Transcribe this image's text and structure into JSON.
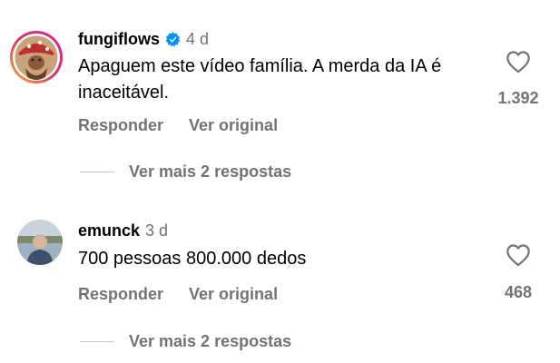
{
  "comments": [
    {
      "username": "fungiflows",
      "verified": true,
      "time": "4 d",
      "text": "Apaguem este vídeo família. A merda da IA é inaceitável.",
      "reply_label": "Responder",
      "original_label": "Ver original",
      "likes": "1.392",
      "more_replies": "Ver mais 2 respostas"
    },
    {
      "username": "emunck",
      "verified": false,
      "time": "3 d",
      "text": "700 pessoas 800.000 dedos",
      "reply_label": "Responder",
      "original_label": "Ver original",
      "likes": "468",
      "more_replies": "Ver mais 2 respostas"
    }
  ],
  "icons": {
    "like": "heart-outline-icon",
    "verified": "verified-badge-icon"
  },
  "colors": {
    "secondary_text": "#737373",
    "verified_blue": "#0095f6",
    "story_ring_start": "#f9b233",
    "story_ring_end": "#d6249f"
  }
}
